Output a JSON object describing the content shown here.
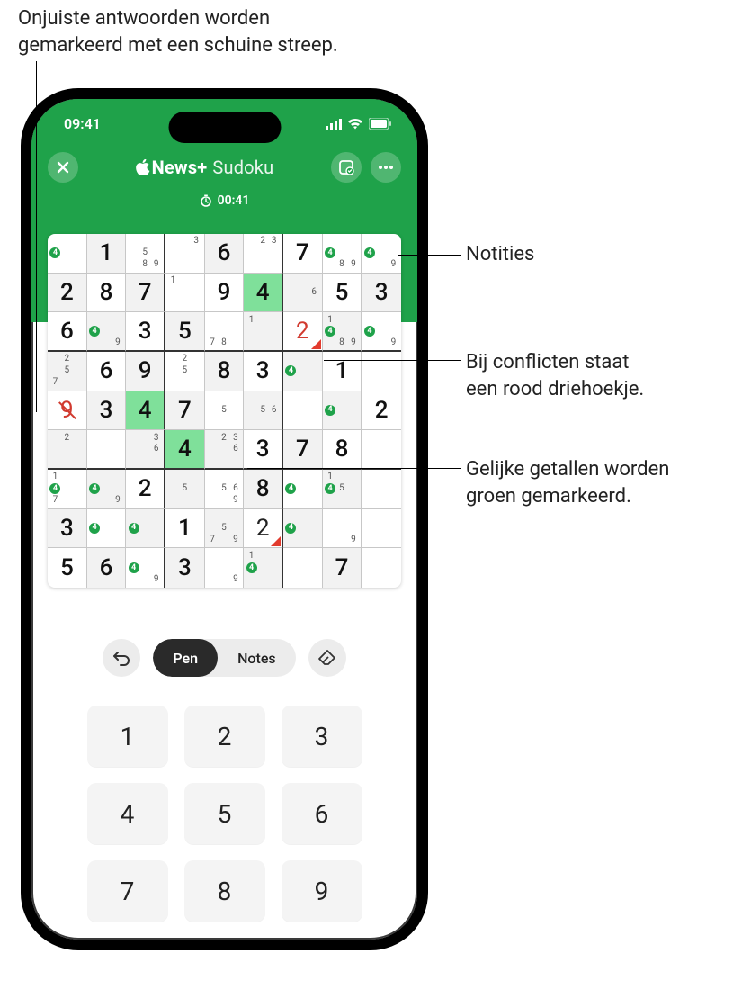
{
  "callouts": {
    "wrong": "Onjuiste antwoorden worden\ngemarkeerd met een schuine streep.",
    "notes": "Notities",
    "conflict": "Bij conflicten staat\neen rood driehoekje.",
    "equal": "Gelijke getallen worden\ngroen gemarkeerd."
  },
  "status": {
    "time": "09:41"
  },
  "header": {
    "brand_bold": "News+",
    "brand_suffix": "Sudoku",
    "timer": "00:41"
  },
  "tools": {
    "pen": "Pen",
    "notes": "Notes"
  },
  "numpad": [
    "1",
    "2",
    "3",
    "4",
    "5",
    "6",
    "7",
    "8",
    "9"
  ],
  "board": [
    [
      {
        "notes": {
          "4": "g"
        }
      },
      {
        "v": "1",
        "given": true,
        "shade": true
      },
      {
        "notes": {
          "5": "",
          "8": "",
          "9": ""
        }
      },
      {
        "notes": {
          "3": ""
        }
      },
      {
        "v": "6",
        "given": true,
        "shade": true
      },
      {
        "notes": {
          "2": "",
          "3": ""
        }
      },
      {
        "v": "7",
        "given": true
      },
      {
        "notes": {
          "4": "g",
          "8": "",
          "9": ""
        }
      },
      {
        "notes": {
          "4": "g",
          "9": ""
        }
      }
    ],
    [
      {
        "v": "2",
        "given": true,
        "shade": true
      },
      {
        "v": "8",
        "given": true
      },
      {
        "v": "7",
        "given": true,
        "shade": true
      },
      {
        "notes": {
          "1": ""
        }
      },
      {
        "v": "9",
        "given": true
      },
      {
        "v": "4",
        "hl": true,
        "given": true
      },
      {
        "notes": {
          "6": ""
        },
        "shade": true
      },
      {
        "v": "5",
        "given": true
      },
      {
        "v": "3",
        "given": true,
        "shade": true
      }
    ],
    [
      {
        "v": "6",
        "given": true
      },
      {
        "notes": {
          "4": "g",
          "9": ""
        },
        "shade": true
      },
      {
        "v": "3",
        "given": true
      },
      {
        "v": "5",
        "given": true,
        "shade": true
      },
      {
        "notes": {
          "7": "",
          "8": ""
        }
      },
      {
        "notes": {
          "1": ""
        },
        "shade": true
      },
      {
        "v": "2",
        "wrong": true,
        "conflict": true
      },
      {
        "notes": {
          "1": "",
          "4": "g",
          "8": "",
          "9": ""
        },
        "shade": true
      },
      {
        "notes": {
          "4": "g",
          "9": ""
        }
      }
    ],
    [
      {
        "notes": {
          "2": "",
          "5": "",
          "7": ""
        },
        "shade": true
      },
      {
        "v": "6",
        "given": true
      },
      {
        "v": "9",
        "given": true,
        "shade": true
      },
      {
        "notes": {
          "2": "",
          "5": ""
        }
      },
      {
        "v": "8",
        "given": true,
        "shade": true
      },
      {
        "v": "3",
        "given": true
      },
      {
        "notes": {
          "4": "g"
        },
        "shade": true
      },
      {
        "v": "1",
        "given": true
      }
    ],
    [
      {
        "v": "9",
        "wrong": true,
        "slash": true
      },
      {
        "v": "3",
        "given": true,
        "shade": true
      },
      {
        "v": "4",
        "hl": true,
        "given": true
      },
      {
        "v": "7",
        "given": true,
        "shade": true
      },
      {
        "notes": {
          "5": ""
        }
      },
      {
        "notes": {
          "5": "",
          "6": ""
        },
        "shade": true
      },
      {},
      {
        "notes": {
          "4": "g"
        },
        "shade": true
      },
      {
        "v": "2",
        "given": true
      }
    ],
    [
      {
        "notes": {
          "2": ""
        },
        "shade": true
      },
      {},
      {
        "notes": {
          "3": "",
          "6": ""
        },
        "shade": true
      },
      {
        "v": "4",
        "hl": true,
        "given": true
      },
      {
        "notes": {
          "2": "",
          "3": "",
          "6": ""
        },
        "shade": true
      },
      {
        "v": "3",
        "given": true
      },
      {
        "v": "7",
        "given": true,
        "shade": true
      },
      {
        "v": "8",
        "given": true
      }
    ],
    [
      {
        "notes": {
          "1": "",
          "4": "g",
          "7": ""
        }
      },
      {
        "notes": {
          "4": "g",
          "9": ""
        },
        "shade": true
      },
      {
        "v": "2",
        "given": true
      },
      {
        "notes": {
          "5": ""
        },
        "shade": true
      },
      {
        "notes": {
          "5": "",
          "6": "",
          "9": ""
        }
      },
      {
        "v": "8",
        "given": true,
        "shade": true
      },
      {
        "notes": {
          "4": "g"
        }
      },
      {
        "notes": {
          "1": "",
          "4": "g",
          "5": ""
        },
        "shade": true
      }
    ],
    [
      {
        "v": "3",
        "given": true,
        "shade": true
      },
      {
        "notes": {
          "4": "g"
        }
      },
      {
        "notes": {
          "4": "g"
        },
        "shade": true
      },
      {
        "v": "1",
        "given": true
      },
      {
        "notes": {
          "5": "",
          "7": "",
          "9": ""
        },
        "shade": true
      },
      {
        "v": "2",
        "conflict": true
      },
      {
        "notes": {
          "4": "g"
        },
        "shade": true
      },
      {
        "notes": {
          "9": ""
        }
      }
    ],
    [
      {
        "v": "5",
        "given": true
      },
      {
        "v": "6",
        "given": true,
        "shade": true
      },
      {
        "notes": {
          "4": "g",
          "9": ""
        }
      },
      {
        "v": "3",
        "given": true,
        "shade": true
      },
      {
        "notes": {
          "9": ""
        }
      },
      {
        "notes": {
          "1": "",
          "4": "g"
        },
        "shade": true
      },
      {},
      {
        "v": "7",
        "given": true,
        "shade": true
      }
    ]
  ]
}
